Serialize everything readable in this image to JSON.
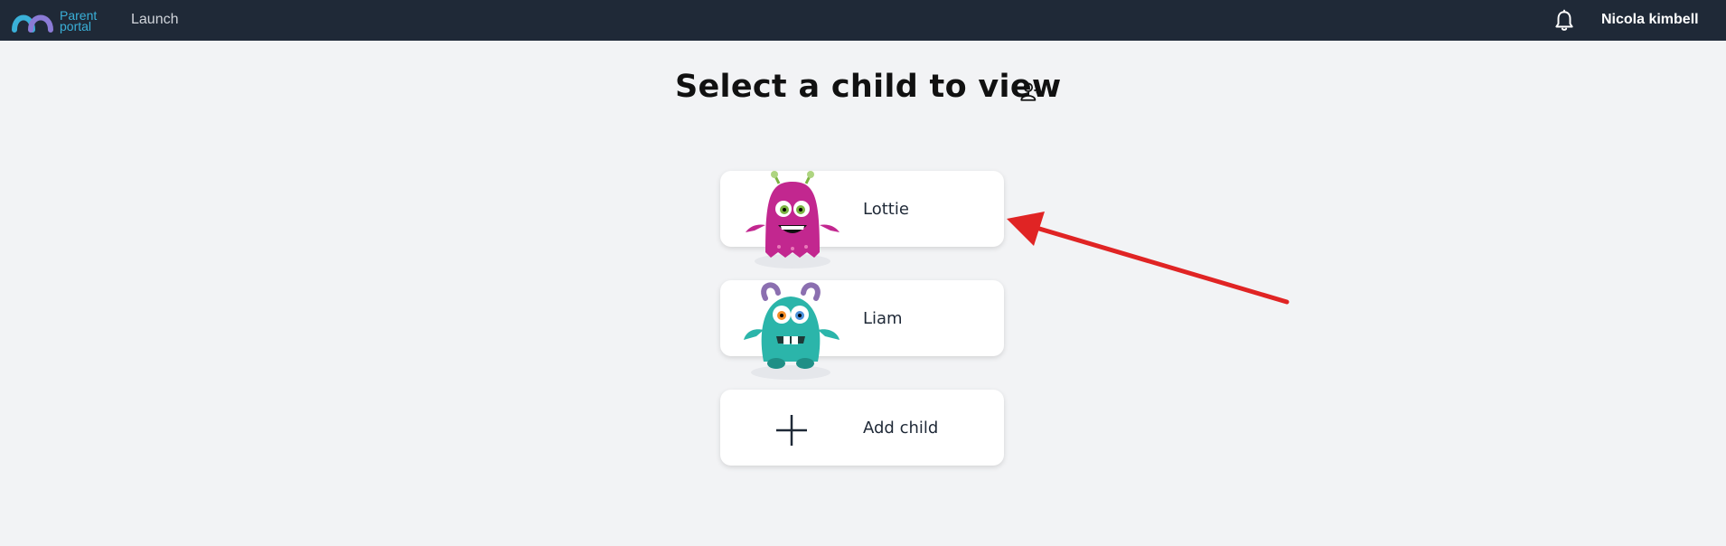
{
  "header": {
    "logo_line1": "Parent",
    "logo_line2": "portal",
    "nav_launch": "Launch",
    "user_name": "Nicola kimbell",
    "bell_icon": "bell-icon"
  },
  "main": {
    "title": "Select a child to view",
    "add_user_icon": "add-user-icon",
    "children": [
      {
        "name": "Lottie",
        "avatar": "pink-monster-avatar"
      },
      {
        "name": "Liam",
        "avatar": "teal-monster-avatar"
      }
    ],
    "add_child_label": "Add child"
  },
  "colors": {
    "topbar": "#1f2937",
    "background": "#f2f3f5",
    "arrow": "#e02424"
  }
}
